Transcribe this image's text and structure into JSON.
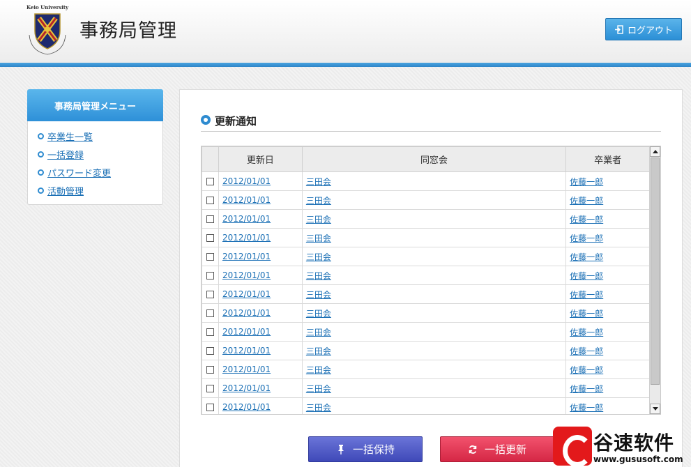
{
  "header": {
    "university": "Keio University",
    "title": "事務局管理",
    "logout_label": "ログアウト"
  },
  "sidebar": {
    "heading": "事務局管理メニュー",
    "items": [
      {
        "label": "卒業生一覧"
      },
      {
        "label": "一括登録"
      },
      {
        "label": "パスワード変更"
      },
      {
        "label": "活動管理"
      }
    ]
  },
  "main": {
    "section_title": "更新通知",
    "table": {
      "columns": [
        "更新日",
        "同窓会",
        "卒業者"
      ],
      "rows": [
        {
          "date": "2012/01/01",
          "alumni": "三田会",
          "graduate": "佐藤一郎"
        },
        {
          "date": "2012/01/01",
          "alumni": "三田会",
          "graduate": "佐藤一郎"
        },
        {
          "date": "2012/01/01",
          "alumni": "三田会",
          "graduate": "佐藤一郎"
        },
        {
          "date": "2012/01/01",
          "alumni": "三田会",
          "graduate": "佐藤一郎"
        },
        {
          "date": "2012/01/01",
          "alumni": "三田会",
          "graduate": "佐藤一郎"
        },
        {
          "date": "2012/01/01",
          "alumni": "三田会",
          "graduate": "佐藤一郎"
        },
        {
          "date": "2012/01/01",
          "alumni": "三田会",
          "graduate": "佐藤一郎"
        },
        {
          "date": "2012/01/01",
          "alumni": "三田会",
          "graduate": "佐藤一郎"
        },
        {
          "date": "2012/01/01",
          "alumni": "三田会",
          "graduate": "佐藤一郎"
        },
        {
          "date": "2012/01/01",
          "alumni": "三田会",
          "graduate": "佐藤一郎"
        },
        {
          "date": "2012/01/01",
          "alumni": "三田会",
          "graduate": "佐藤一郎"
        },
        {
          "date": "2012/01/01",
          "alumni": "三田会",
          "graduate": "佐藤一郎"
        },
        {
          "date": "2012/01/01",
          "alumni": "三田会",
          "graduate": "佐藤一郎"
        }
      ]
    },
    "hold_label": "一括保持",
    "update_label": "一括更新"
  },
  "watermark": {
    "text": "谷速软件",
    "url": "www.gususoft.com"
  },
  "colors": {
    "accent": "#2e8bd0",
    "hold_button": "#3f49b8",
    "update_button": "#d52745",
    "link": "#1a6fb5"
  }
}
